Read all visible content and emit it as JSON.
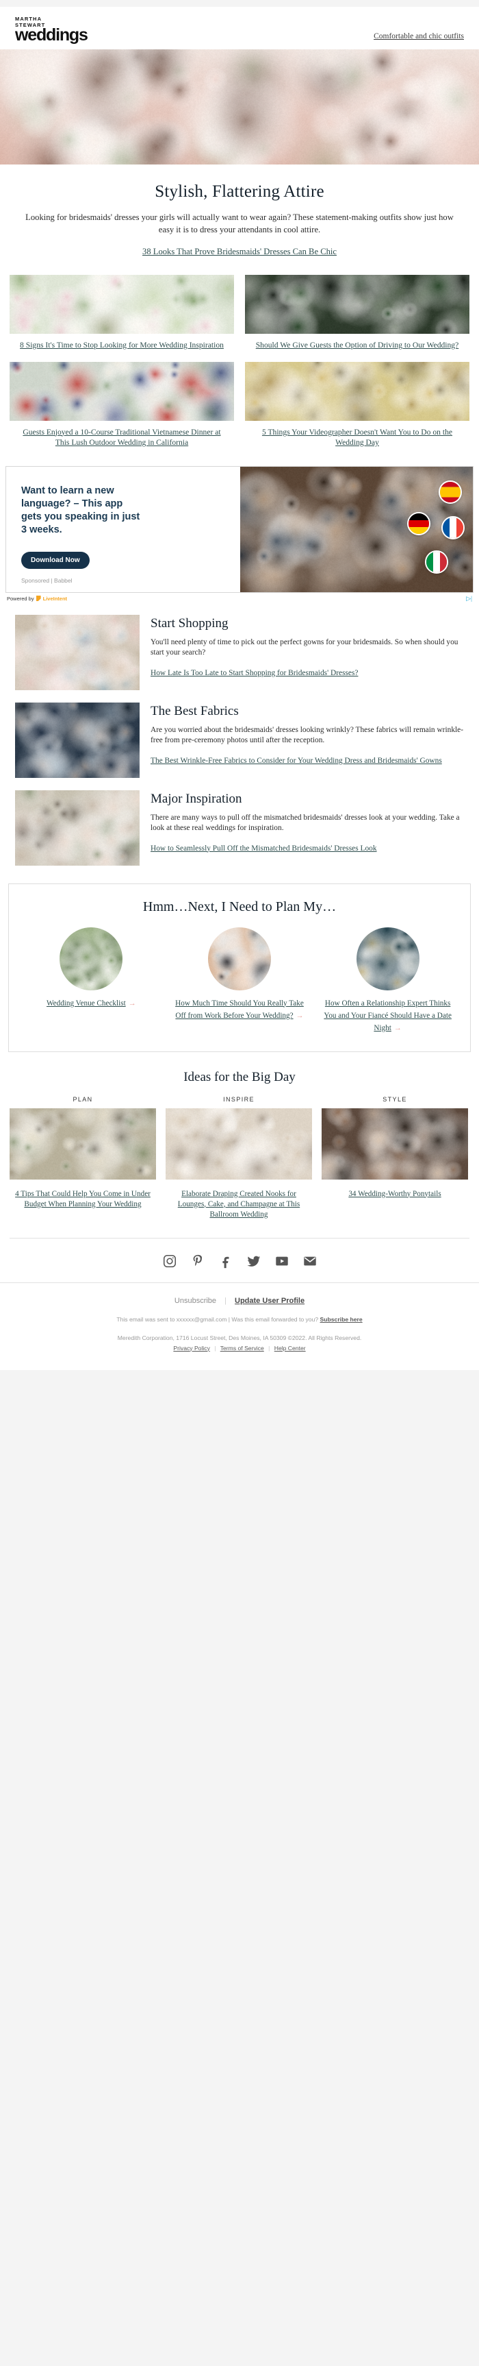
{
  "header": {
    "logo_kicker_line1": "MARTHA",
    "logo_kicker_line2": "STEWART",
    "logo_wordmark": "weddings",
    "top_link": "Comfortable and chic outfits"
  },
  "intro": {
    "title": "Stylish, Flattering Attire",
    "body": "Looking for bridesmaids' dresses your girls will actually want to wear again? These statement-making outfits show just how easy it is to dress your attendants in cool attire.",
    "cta": "38 Looks That Prove Bridesmaids' Dresses Can Be Chic"
  },
  "grid": {
    "items": [
      {
        "caption": "8 Signs It's Time to Stop Looking for More Wedding Inspiration"
      },
      {
        "caption": "Should We Give Guests the Option of Driving to Our Wedding?"
      },
      {
        "caption": "Guests Enjoyed a 10-Course Traditional Vietnamese Dinner at This Lush Outdoor Wedding in California"
      },
      {
        "caption": "5 Things Your Videographer Doesn't Want You to Do on the Wedding Day"
      }
    ]
  },
  "ad": {
    "headline": "Want to learn a new language? – This app gets you speaking in just 3 weeks.",
    "button": "Download Now",
    "sponsor": "Sponsored | Babbel",
    "powered_by": "Powered by",
    "network": "LiveIntent",
    "adchoices": "AdChoices",
    "flags": [
      "spain-flag",
      "germany-flag",
      "france-flag",
      "italy-flag"
    ]
  },
  "features": [
    {
      "title": "Start Shopping",
      "body": "You'll need plenty of time to pick out the perfect gowns for your bridesmaids. So when should you start your search?",
      "link": "How Late Is Too Late to Start Shopping for Bridesmaids' Dresses?"
    },
    {
      "title": "The Best Fabrics",
      "body": "Are you worried about the bridesmaids' dresses looking wrinkly? These fabrics will remain wrinkle-free from pre-ceremony photos until after the reception.",
      "link": "The Best Wrinkle-Free Fabrics to Consider for Your Wedding Dress and Bridesmaids' Gowns"
    },
    {
      "title": "Major Inspiration",
      "body": "There are many ways to pull off the mismatched bridesmaids' dresses look at your wedding. Take a look at these real weddings for inspiration.",
      "link": "How to Seamlessly Pull Off the Mismatched Bridesmaids' Dresses Look"
    }
  ],
  "plan": {
    "title": "Hmm…Next, I Need to Plan My…",
    "items": [
      {
        "label": "Wedding Venue Checklist",
        "arrow": "→"
      },
      {
        "label": "How Much Time Should You Really Take Off from Work Before Your Wedding?",
        "arrow": "→"
      },
      {
        "label": "How Often a Relationship Expert Thinks You and Your Fiancé Should Have a Date Night",
        "arrow": "→"
      }
    ]
  },
  "ideas": {
    "title": "Ideas for the Big Day",
    "columns": [
      {
        "kicker": "PLAN",
        "caption": "4 Tips That Could Help You Come in Under Budget When Planning Your Wedding"
      },
      {
        "kicker": "INSPIRE",
        "caption": "Elaborate Draping Created Nooks for Lounges, Cake, and Champagne at This Ballroom Wedding"
      },
      {
        "kicker": "STYLE",
        "caption": "34 Wedding-Worthy Ponytails"
      }
    ]
  },
  "social": {
    "icons": [
      "instagram-icon",
      "pinterest-icon",
      "facebook-icon",
      "twitter-icon",
      "youtube-icon",
      "email-icon"
    ]
  },
  "footer": {
    "unsubscribe": "Unsubscribe",
    "update_profile": "Update User Profile",
    "sent_to": "This email was sent to xxxxxx@gmail.com  |  Was this email forwarded to you?",
    "subscribe_here": "Subscribe here",
    "legal": "Meredith Corporation, 1716 Locust Street, Des Moines, IA 50309 ©2022. All Rights Reserved.",
    "privacy": "Privacy Policy",
    "terms": "Terms of Service",
    "help": "Help Center"
  },
  "colors": {
    "link": "#2f4f4f",
    "heading": "#14202b",
    "ad_navy": "#16324a",
    "arrow_pink": "#e8a09a",
    "liveintent_orange": "#f5a623"
  }
}
